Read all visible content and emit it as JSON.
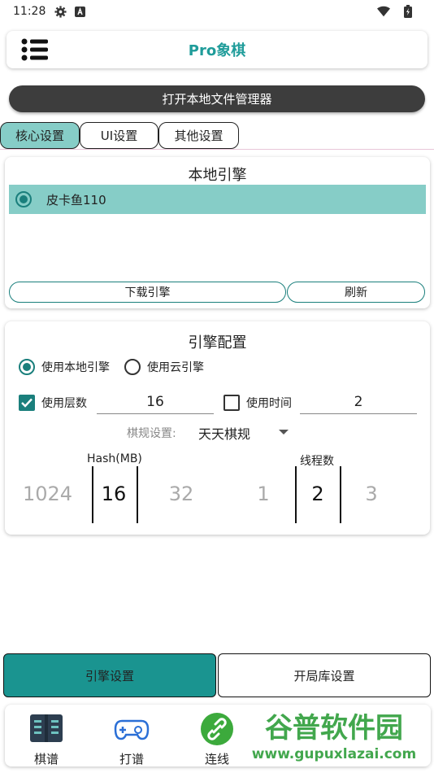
{
  "status": {
    "time": "11:28"
  },
  "appbar": {
    "title": "Pro象棋"
  },
  "file_manager_button": "打开本地文件管理器",
  "tabs": [
    {
      "label": "核心设置",
      "active": true
    },
    {
      "label": "UI设置",
      "active": false
    },
    {
      "label": "其他设置",
      "active": false
    }
  ],
  "local_engine": {
    "title": "本地引擎",
    "engines": [
      {
        "name": "皮卡鱼110",
        "selected": true
      }
    ],
    "download_label": "下载引擎",
    "refresh_label": "刷新"
  },
  "engine_config": {
    "title": "引擎配置",
    "use_local_label": "使用本地引擎",
    "use_cloud_label": "使用云引擎",
    "use_local_selected": true,
    "use_depth_label": "使用层数",
    "use_depth_checked": true,
    "depth_value": "16",
    "use_time_label": "使用时间",
    "use_time_checked": false,
    "time_value": "2",
    "rules_label": "棋规设置:",
    "rules_value": "天天棋规",
    "hash_label": "Hash(MB)",
    "hash_options": [
      "1024",
      "16",
      "32"
    ],
    "hash_selected": "16",
    "threads_label": "线程数",
    "thread_options": [
      "1",
      "2",
      "3"
    ],
    "thread_selected": "2"
  },
  "bottom_tabs": [
    {
      "label": "引擎设置",
      "active": true
    },
    {
      "label": "开局库设置",
      "active": false
    }
  ],
  "nav": [
    {
      "label": "棋谱",
      "icon": "book-icon"
    },
    {
      "label": "打谱",
      "icon": "gamepad-icon"
    },
    {
      "label": "连线",
      "icon": "link-icon"
    }
  ],
  "watermark": {
    "text": "谷普软件园",
    "url": "www.gupuxlazai.com"
  },
  "colors": {
    "accent": "#1a9490",
    "light_accent": "#86cdc7",
    "title_teal": "#1f9c9a"
  }
}
